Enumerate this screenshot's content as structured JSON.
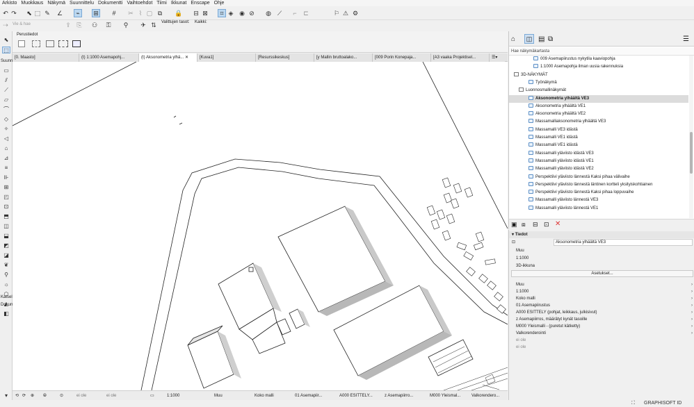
{
  "menu": [
    "Arkisto",
    "Muokkaus",
    "Näkymä",
    "Suunnittelu",
    "Dokumentti",
    "Vaihtoehdot",
    "Tiimi",
    "Ikkunat",
    "Enscape",
    "Ohje"
  ],
  "toolbar2": {
    "vie_label": "Vie & hae",
    "valittujen_label": "Valittujen tasot:",
    "kaikki_label": "Kaikki:"
  },
  "infobox": {
    "title": "Perustiedot"
  },
  "toolbox": {
    "section1": "Suunn",
    "section2": "Katsel",
    "section3": "Dokum"
  },
  "tabs": [
    {
      "label": "[0. Maasto]",
      "active": false
    },
    {
      "label": "(t) 1:1000 Asemapohj...",
      "active": false
    },
    {
      "label": "(t) Aksonometria ylhä...",
      "active": true
    },
    {
      "label": "[Kuva1]",
      "active": false
    },
    {
      "label": "[Resurssikeskus]",
      "active": false
    },
    {
      "label": "[y Mallin bruttoalako...",
      "active": false
    },
    {
      "label": "[009 Porin Konepaja...",
      "active": false
    },
    {
      "label": "[A3 vaaka Projektisel...",
      "active": false
    }
  ],
  "status": {
    "layer_left": "ei ole",
    "layer_left2": "ei ole",
    "scale": "1:1000",
    "muu": "Muu",
    "model": "Koko malli",
    "asemapiirustus": "01 Asemapiir...",
    "esittely": "A000 ESITTELY...",
    "asemapiirros": "z Asemapiirro...",
    "yleismalli": "M000 Yleismal...",
    "valkorender": "Valkorendero..."
  },
  "navigator": {
    "search_placeholder": "Hae näkymäkartasta",
    "rows": [
      {
        "label": "009 Asemapiirustus nykytila kaaviopohja",
        "indent": 5,
        "type": "view",
        "sel": false
      },
      {
        "label": "1:1000 Asemapohja ilman uusia rakennuksia",
        "indent": 5,
        "type": "view",
        "sel": false
      },
      {
        "label": "3D-NÄKYMÄT",
        "indent": 1,
        "type": "folder",
        "sel": false
      },
      {
        "label": "Työnäkymä",
        "indent": 4,
        "type": "view",
        "sel": false
      },
      {
        "label": "Luonnosmallinäkymät",
        "indent": 2,
        "type": "folder",
        "sel": false
      },
      {
        "label": "Aksonometria ylhäältä VE3",
        "indent": 4,
        "type": "view",
        "sel": true
      },
      {
        "label": "Aksonometria ylhäältä VE1",
        "indent": 4,
        "type": "view",
        "sel": false
      },
      {
        "label": "Aksonometria ylhäältä VE2",
        "indent": 4,
        "type": "view",
        "sel": false
      },
      {
        "label": "Massamalliaksonometria ylhäältä VE3",
        "indent": 4,
        "type": "view",
        "sel": false
      },
      {
        "label": "Massamalli VE3 idästä",
        "indent": 4,
        "type": "view",
        "sel": false
      },
      {
        "label": "Massamalli VE1 idästä",
        "indent": 4,
        "type": "view",
        "sel": false
      },
      {
        "label": "Massamalli VE1 idästä",
        "indent": 4,
        "type": "view",
        "sel": false
      },
      {
        "label": "Massamalli yläviisto idästä VE3",
        "indent": 4,
        "type": "view",
        "sel": false
      },
      {
        "label": "Massamalli yläviisto idästä VE1",
        "indent": 4,
        "type": "view",
        "sel": false
      },
      {
        "label": "Massamalli yläviisto idästä VE2",
        "indent": 4,
        "type": "view",
        "sel": false
      },
      {
        "label": "Perspektiivi yläviisto lännestä Kaksi pihaa välivaihe",
        "indent": 4,
        "type": "view",
        "sel": false
      },
      {
        "label": "Perspektiivi yläviisto lännestä läntinen kortteli yksityiskohtiainen",
        "indent": 4,
        "type": "view",
        "sel": false
      },
      {
        "label": "Perspektiivi yläviisto lännestä Kaksi pihaa loppuvaihe",
        "indent": 4,
        "type": "view",
        "sel": false
      },
      {
        "label": "Massamalli yläviisto lännestä VE3",
        "indent": 4,
        "type": "view",
        "sel": false
      },
      {
        "label": "Massamalli yläviisto lännestä VE1",
        "indent": 4,
        "type": "view",
        "sel": false
      }
    ]
  },
  "props": {
    "header": "Tiedot",
    "name_value": "Aksonometria ylhäältä VE3",
    "muu": "Muu",
    "scale": "1:1000",
    "window": "3D-ikkuna",
    "asetukset": "Asetukset...",
    "list": [
      "Muu",
      "1:1000",
      "Koko malli",
      "01 Asemapiirustus",
      "A000 ESITTELY (pohjat, leikkaus, julkisivut)",
      "z Asemapiirros, määrätyt kynät tasoille",
      "M000 Yleismalli - (puretut kätketty)",
      "Valkorenderointi",
      "ei ole",
      "ei ole"
    ]
  },
  "bottombar": {
    "brand": "GRAPHISOFT ID"
  }
}
